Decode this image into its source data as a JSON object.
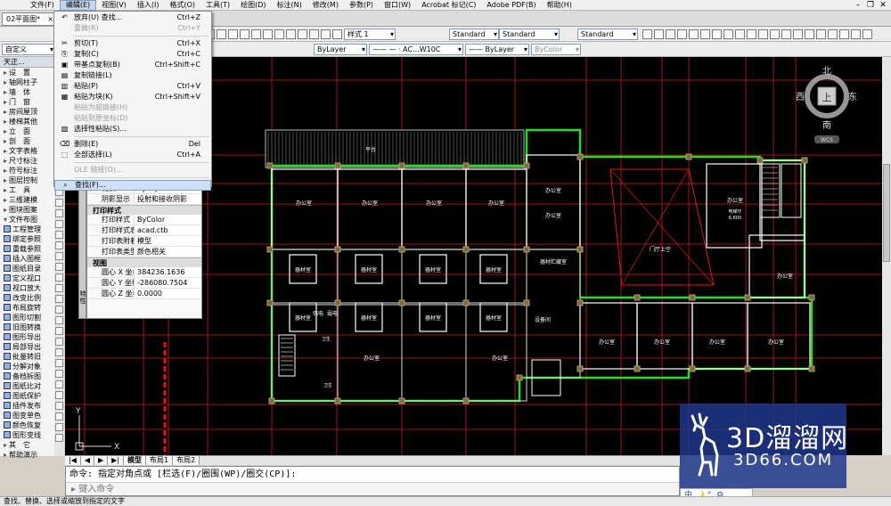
{
  "menubar": {
    "items": [
      "文件(F)",
      "编辑(E)",
      "视图(V)",
      "插入(I)",
      "格式(O)",
      "工具(T)",
      "绘图(D)",
      "标注(N)",
      "修改(M)",
      "参数(P)",
      "窗口(W)",
      "Acrobat 标记(C)",
      "Adobe PDF(B)",
      "帮助(H)"
    ],
    "active_index": 1
  },
  "drawing_tab": {
    "title": "02平面图*",
    "close": "×"
  },
  "toolbar": {
    "workspace": "自定义",
    "style1": "样式 1",
    "text_style": "Standard",
    "dim_style": "Standard",
    "table_style": "Standard",
    "layer": "ByLayer",
    "linetype": "—— — · AC...W10C",
    "lineweight": "—— ByLayer",
    "plot_style": "ByColor"
  },
  "edit_menu": {
    "items": [
      {
        "glyph": "↶",
        "label": "放弃(U) 查找...",
        "shortcut": "Ctrl+Z",
        "disabled": false
      },
      {
        "glyph": "",
        "label": "重做(R)",
        "shortcut": "Ctrl+Y",
        "disabled": true
      },
      {
        "glyph": "✂",
        "label": "剪切(T)",
        "shortcut": "Ctrl+X",
        "disabled": false,
        "sep_before": true
      },
      {
        "glyph": "⎘",
        "label": "复制(C)",
        "shortcut": "Ctrl+C",
        "disabled": false
      },
      {
        "glyph": "▣",
        "label": "带基点复制(B)",
        "shortcut": "Ctrl+Shift+C",
        "disabled": false
      },
      {
        "glyph": "▤",
        "label": "复制链接(L)",
        "shortcut": "",
        "disabled": false
      },
      {
        "glyph": "▥",
        "label": "粘贴(P)",
        "shortcut": "Ctrl+V",
        "disabled": false
      },
      {
        "glyph": "▦",
        "label": "粘贴为块(K)",
        "shortcut": "Ctrl+Shift+V",
        "disabled": false
      },
      {
        "glyph": "",
        "label": "粘贴为超链接(H)",
        "shortcut": "",
        "disabled": true
      },
      {
        "glyph": "",
        "label": "粘贴到原坐标(D)",
        "shortcut": "",
        "disabled": true
      },
      {
        "glyph": "▧",
        "label": "选择性粘贴(S)...",
        "shortcut": "",
        "disabled": false
      },
      {
        "glyph": "⌫",
        "label": "删除(E)",
        "shortcut": "Del",
        "disabled": false,
        "sep_before": true
      },
      {
        "glyph": "⬚",
        "label": "全部选择(L)",
        "shortcut": "Ctrl+A",
        "disabled": false
      },
      {
        "glyph": "",
        "label": "OLE 链接(O)...",
        "shortcut": "",
        "disabled": true,
        "sep_before": true
      },
      {
        "glyph": "⌕",
        "label": "查找(F)...",
        "shortcut": "",
        "disabled": false,
        "sep_before": true,
        "highlight": true
      }
    ]
  },
  "left_panel": {
    "title": "天正...",
    "items": [
      {
        "arrow": "▸",
        "label": "设　置"
      },
      {
        "arrow": "▸",
        "label": "轴网柱子"
      },
      {
        "arrow": "▸",
        "label": "墙　体"
      },
      {
        "arrow": "▸",
        "label": "门　窗"
      },
      {
        "arrow": "▸",
        "label": "房间屋顶"
      },
      {
        "arrow": "▸",
        "label": "楼梯其他"
      },
      {
        "arrow": "▸",
        "label": "立　面"
      },
      {
        "arrow": "▸",
        "label": "剖　面"
      },
      {
        "arrow": "▸",
        "label": "文字表格"
      },
      {
        "arrow": "▸",
        "label": "尺寸标注"
      },
      {
        "arrow": "▸",
        "label": "符号标注"
      },
      {
        "arrow": "▸",
        "label": "图层控制"
      },
      {
        "arrow": "▸",
        "label": "工　具"
      },
      {
        "arrow": "▸",
        "label": "三维建模"
      },
      {
        "arrow": "▸",
        "label": "图块图案"
      },
      {
        "arrow": "▾",
        "label": "文件布图"
      },
      {
        "icon": true,
        "label": "工程管理"
      },
      {
        "icon": true,
        "label": "绑定参照"
      },
      {
        "icon": true,
        "label": "重载参照"
      },
      {
        "icon": true,
        "label": "插入图框"
      },
      {
        "icon": true,
        "label": "图纸目录"
      },
      {
        "icon": true,
        "label": "定义视口"
      },
      {
        "icon": true,
        "label": "视口放大"
      },
      {
        "icon": true,
        "label": "改变比例"
      },
      {
        "icon": true,
        "label": "布局旋转"
      },
      {
        "icon": true,
        "label": "图形切割"
      },
      {
        "icon": true,
        "label": "旧图转换"
      },
      {
        "icon": true,
        "label": "图形导出"
      },
      {
        "icon": true,
        "label": "局部导出"
      },
      {
        "icon": true,
        "label": "批量转旧"
      },
      {
        "icon": true,
        "label": "分解对象"
      },
      {
        "icon": true,
        "label": "备档拆图"
      },
      {
        "icon": true,
        "label": "图纸比对"
      },
      {
        "icon": true,
        "label": "图纸保护"
      },
      {
        "icon": true,
        "label": "插件发布"
      },
      {
        "icon": true,
        "label": "图变单色"
      },
      {
        "icon": true,
        "label": "颜色恢复"
      },
      {
        "icon": true,
        "label": "图形变线"
      },
      {
        "arrow": "▸",
        "label": "其　它"
      },
      {
        "arrow": "▸",
        "label": "帮助演示"
      }
    ]
  },
  "properties": {
    "side_label": "特性",
    "rows_top": [
      {
        "k": "材质",
        "v": "ByLayer"
      },
      {
        "k": "阴影显示",
        "v": "投射和接收阴影"
      }
    ],
    "print_section": "打印样式",
    "rows_print": [
      {
        "k": "打印样式",
        "v": "ByColor"
      },
      {
        "k": "打印样式表",
        "v": "acad.ctb"
      },
      {
        "k": "打印表附着到",
        "v": "模型"
      },
      {
        "k": "打印表类型",
        "v": "颜色相关"
      }
    ],
    "view_section": "视图",
    "rows_view": [
      {
        "k": "圆心 X 坐标",
        "v": "384236.1636"
      },
      {
        "k": "圆心 Y 坐标",
        "v": "-286080.7504"
      },
      {
        "k": "圆心 Z 坐标",
        "v": "0.0000"
      }
    ]
  },
  "compass": {
    "north": "北",
    "south": "南",
    "east": "东",
    "west": "西",
    "center": "上",
    "wcs": "WCS"
  },
  "plan": {
    "platform": "平台",
    "offices": [
      "办公室",
      "办公室",
      "办公室",
      "办公室",
      "办公室",
      "办公室",
      "办公室",
      "办公室",
      "办公室",
      "办公室",
      "办公室",
      "办公室",
      "办公室",
      "办公室"
    ],
    "equip": [
      "器材室",
      "器材室",
      "器材室",
      "器材室",
      "器材室",
      "器材室",
      "器材室",
      "器材室"
    ],
    "equip_store": "器材贮藏室",
    "lobby": "门厅上空",
    "e_room": "电梯厅",
    "e_level": "6.600",
    "wc1": "卫生",
    "wc2": "卫生",
    "strong": "强电",
    "weak": "弱电",
    "facility": "设备间"
  },
  "layout_tabs": [
    "模型",
    "布局1",
    "布局2"
  ],
  "layout_nav": [
    "|◀",
    "◀",
    "▶",
    "▶|"
  ],
  "command": {
    "prompt": "命令: 指定对角点或 [栏选(F)/圈围(WP)/圈交(CP)]:",
    "input_placeholder": "键入命令"
  },
  "status_text": "查找、替换、选择或缩放到指定的文字",
  "ime": "中 🌙 °, ⚙",
  "watermark": {
    "big": "3D溜溜网",
    "small": "3D66.COM"
  },
  "colors": {
    "green": "#22dd22",
    "red": "#e01818",
    "bg": "#000000",
    "accent": "#2b4f9e"
  }
}
